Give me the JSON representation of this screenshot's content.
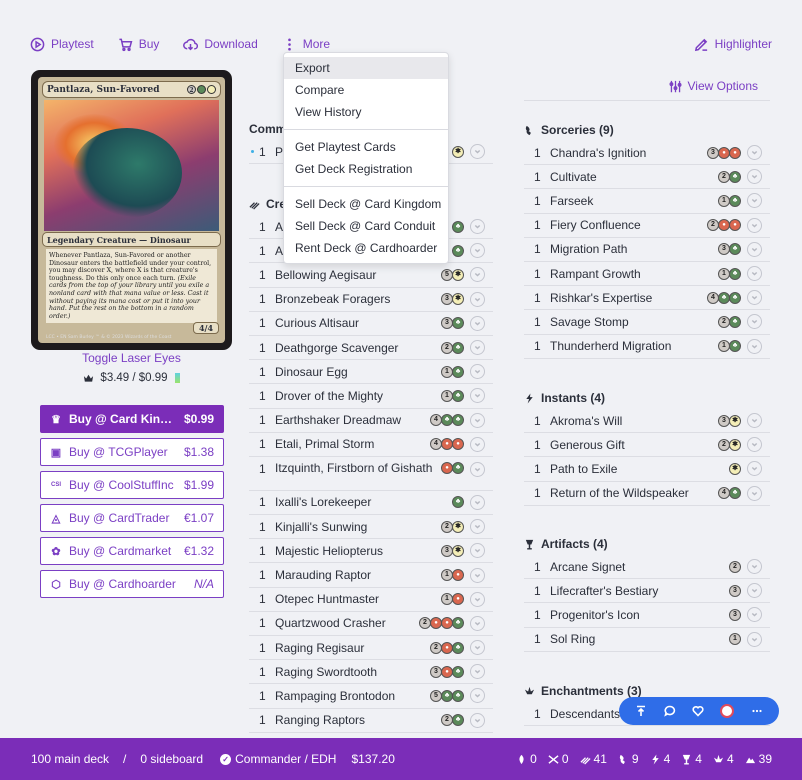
{
  "toolbar": {
    "playtest": "Playtest",
    "buy": "Buy",
    "download": "Download",
    "more": "More",
    "highlighter": "Highlighter",
    "view_options": "View Options"
  },
  "dropdown": {
    "items": [
      "Export",
      "Compare",
      "View History",
      "Get Playtest Cards",
      "Get Deck Registration",
      "Sell Deck @ Card Kingdom",
      "Sell Deck @ Card Conduit",
      "Rent Deck @ Cardhoarder"
    ]
  },
  "card": {
    "name": "Pantlaza, Sun-Favored",
    "type_line": "Legendary Creature — Dinosaur",
    "rules_text": "Whenever Pantlaza, Sun-Favored or another Dinosaur enters the battlefield under your control, you may discover X, where X is that creature's toughness. Do this only once each turn.",
    "reminder_text": "(Exile cards from the top of your library until you exile a nonland card with that mana value or less. Cast it without paying its mana cost or put it into your hand. Put the rest on the bottom in a random order.)",
    "pt": "4/4",
    "footer": "LCC • EN Sam Burley",
    "footer_right": "™ & © 2023 Wizards of the Coast"
  },
  "toggle_laser": "Toggle Laser Eyes",
  "card_price": "$3.49 / $0.99",
  "buy_buttons": [
    {
      "label": "Buy @ Card Kingd...",
      "price": "$0.99",
      "icon": "crown-icon"
    },
    {
      "label": "Buy @ TCGPlayer",
      "price": "$1.38",
      "icon": "tcg-icon"
    },
    {
      "label": "Buy @ CoolStuffInc",
      "price": "$1.99",
      "icon": "csi-icon"
    },
    {
      "label": "Buy @ CardTrader",
      "price": "€1.07",
      "icon": "cardtrader-icon"
    },
    {
      "label": "Buy @ Cardmarket",
      "price": "€1.32",
      "icon": "cardmarket-icon"
    },
    {
      "label": "Buy @ Cardhoarder",
      "price": "N/A",
      "icon": "cardhoarder-icon"
    }
  ],
  "commander": {
    "title": "Comm",
    "rows": [
      {
        "q": "1",
        "name": "P",
        "mana": [
          "W"
        ]
      }
    ]
  },
  "creatures": {
    "title": "Cre",
    "rows": [
      {
        "q": "1",
        "name": "A",
        "mana": [
          "G"
        ]
      },
      {
        "q": "1",
        "name": "A",
        "mana": [
          "G"
        ]
      },
      {
        "q": "1",
        "name": "Bellowing Aegisaur",
        "mana": [
          "5",
          "W"
        ]
      },
      {
        "q": "1",
        "name": "Bronzebeak Foragers",
        "mana": [
          "3",
          "W"
        ]
      },
      {
        "q": "1",
        "name": "Curious Altisaur",
        "mana": [
          "3",
          "G"
        ]
      },
      {
        "q": "1",
        "name": "Deathgorge Scavenger",
        "mana": [
          "2",
          "G"
        ]
      },
      {
        "q": "1",
        "name": "Dinosaur Egg",
        "mana": [
          "1",
          "G"
        ]
      },
      {
        "q": "1",
        "name": "Drover of the Mighty",
        "mana": [
          "1",
          "G"
        ]
      },
      {
        "q": "1",
        "name": "Earthshaker Dreadmaw",
        "mana": [
          "4",
          "G",
          "G"
        ]
      },
      {
        "q": "1",
        "name": "Etali, Primal Storm",
        "mana": [
          "4",
          "R",
          "R"
        ]
      },
      {
        "q": "1",
        "name": "Itzquinth, Firstborn of Gishath",
        "mana": [
          "R",
          "G"
        ],
        "tall": true
      },
      {
        "q": "1",
        "name": "Ixalli's Lorekeeper",
        "mana": [
          "G"
        ]
      },
      {
        "q": "1",
        "name": "Kinjalli's Sunwing",
        "mana": [
          "2",
          "W"
        ]
      },
      {
        "q": "1",
        "name": "Majestic Heliopterus",
        "mana": [
          "3",
          "W"
        ]
      },
      {
        "q": "1",
        "name": "Marauding Raptor",
        "mana": [
          "1",
          "R"
        ]
      },
      {
        "q": "1",
        "name": "Otepec Huntmaster",
        "mana": [
          "1",
          "R"
        ]
      },
      {
        "q": "1",
        "name": "Quartzwood Crasher",
        "mana": [
          "2",
          "R",
          "R",
          "G"
        ]
      },
      {
        "q": "1",
        "name": "Raging Regisaur",
        "mana": [
          "2",
          "R",
          "G"
        ]
      },
      {
        "q": "1",
        "name": "Raging Swordtooth",
        "mana": [
          "3",
          "R",
          "G"
        ]
      },
      {
        "q": "1",
        "name": "Rampaging Brontodon",
        "mana": [
          "5",
          "G",
          "G"
        ]
      },
      {
        "q": "1",
        "name": "Ranging Raptors",
        "mana": [
          "2",
          "G"
        ]
      }
    ]
  },
  "sorceries": {
    "title": "Sorceries (9)",
    "rows": [
      {
        "q": "1",
        "name": "Chandra's Ignition",
        "mana": [
          "3",
          "R",
          "R"
        ]
      },
      {
        "q": "1",
        "name": "Cultivate",
        "mana": [
          "2",
          "G"
        ]
      },
      {
        "q": "1",
        "name": "Farseek",
        "mana": [
          "1",
          "G"
        ]
      },
      {
        "q": "1",
        "name": "Fiery Confluence",
        "mana": [
          "2",
          "R",
          "R"
        ]
      },
      {
        "q": "1",
        "name": "Migration Path",
        "mana": [
          "3",
          "G"
        ]
      },
      {
        "q": "1",
        "name": "Rampant Growth",
        "mana": [
          "1",
          "G"
        ]
      },
      {
        "q": "1",
        "name": "Rishkar's Expertise",
        "mana": [
          "4",
          "G",
          "G"
        ]
      },
      {
        "q": "1",
        "name": "Savage Stomp",
        "mana": [
          "2",
          "G"
        ]
      },
      {
        "q": "1",
        "name": "Thunderherd Migration",
        "mana": [
          "1",
          "G"
        ]
      }
    ]
  },
  "instants": {
    "title": "Instants (4)",
    "rows": [
      {
        "q": "1",
        "name": "Akroma's Will",
        "mana": [
          "3",
          "W"
        ]
      },
      {
        "q": "1",
        "name": "Generous Gift",
        "mana": [
          "2",
          "W"
        ]
      },
      {
        "q": "1",
        "name": "Path to Exile",
        "mana": [
          "W"
        ]
      },
      {
        "q": "1",
        "name": "Return of the Wildspeaker",
        "mana": [
          "4",
          "G"
        ]
      }
    ]
  },
  "artifacts": {
    "title": "Artifacts (4)",
    "rows": [
      {
        "q": "1",
        "name": "Arcane Signet",
        "mana": [
          "2"
        ]
      },
      {
        "q": "1",
        "name": "Lifecrafter's Bestiary",
        "mana": [
          "3"
        ]
      },
      {
        "q": "1",
        "name": "Progenitor's Icon",
        "mana": [
          "3"
        ]
      },
      {
        "q": "1",
        "name": "Sol Ring",
        "mana": [
          "1"
        ]
      }
    ]
  },
  "enchantments": {
    "title": "Enchantments (3)",
    "rows": [
      {
        "q": "1",
        "name": "Descendants",
        "mana": []
      }
    ]
  },
  "bottom": {
    "main_deck": "100 main deck",
    "separator": "/",
    "sideboard": "0 sideboard",
    "format": "Commander / EDH",
    "total": "$137.20",
    "counts": [
      {
        "icon": "land-icon",
        "value": "0"
      },
      {
        "icon": "planeswalker-icon",
        "value": "0"
      },
      {
        "icon": "creature-icon",
        "value": "41"
      },
      {
        "icon": "sorcery-icon",
        "value": "9"
      },
      {
        "icon": "instant-icon",
        "value": "4"
      },
      {
        "icon": "artifact-icon",
        "value": "4"
      },
      {
        "icon": "enchantment-icon",
        "value": "4"
      },
      {
        "icon": "land-count-icon",
        "value": "39"
      }
    ]
  },
  "colors": {
    "accent": "#7b3fc4",
    "bottom_bar": "#7b2db8",
    "pill": "#2f6de8"
  }
}
